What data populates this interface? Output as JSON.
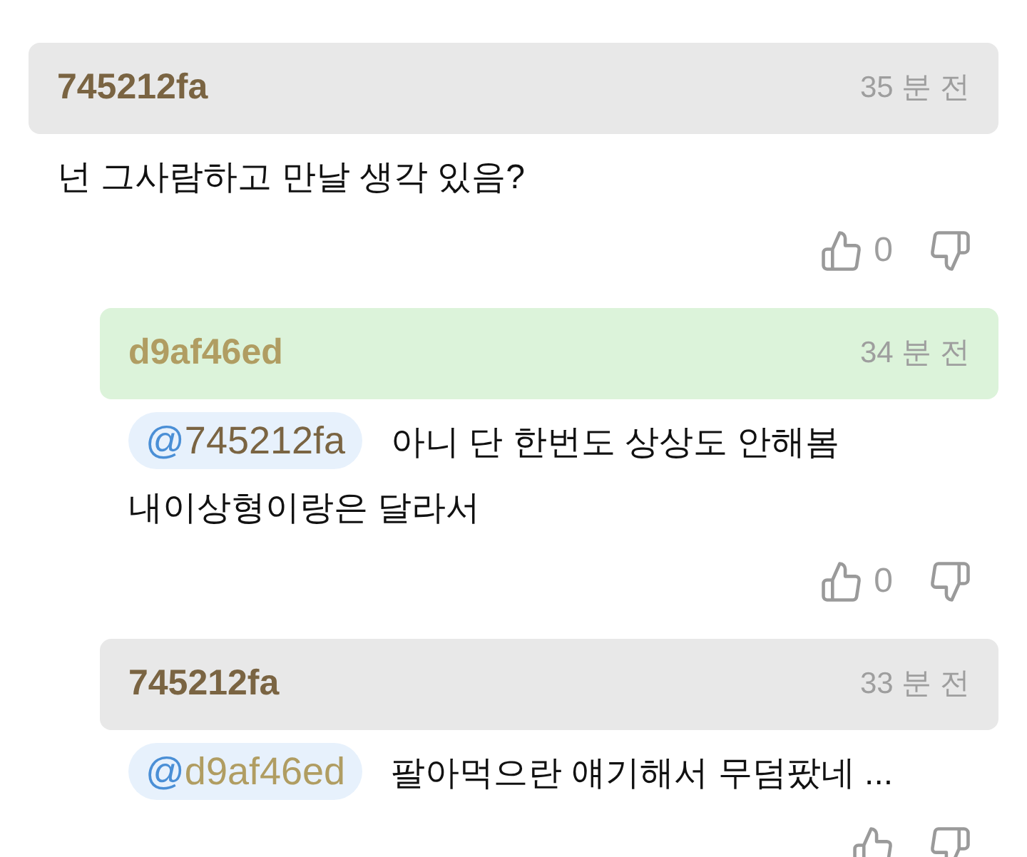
{
  "comments": [
    {
      "author": "745212fa",
      "color": "#7a6442",
      "highlighted": false,
      "time": "35 분 전",
      "text": "넌 그사람하고 만날 생각 있음?",
      "likes": "0",
      "replies": [
        {
          "author": "d9af46ed",
          "color": "#b09d62",
          "highlighted": true,
          "time": "34 분 전",
          "mention": {
            "at": "@",
            "name": "745212fa",
            "color": "#7a6442"
          },
          "text": "아니 단 한번도 상상도 안해봄\n내이상형이랑은 달라서",
          "likes": "0"
        },
        {
          "author": "745212fa",
          "color": "#7a6442",
          "highlighted": false,
          "time": "33 분 전",
          "mention": {
            "at": "@",
            "name": "d9af46ed",
            "color": "#b09d62"
          },
          "text": "팔아먹으란 얘기해서 무덤팠네 ..."
        }
      ]
    }
  ]
}
